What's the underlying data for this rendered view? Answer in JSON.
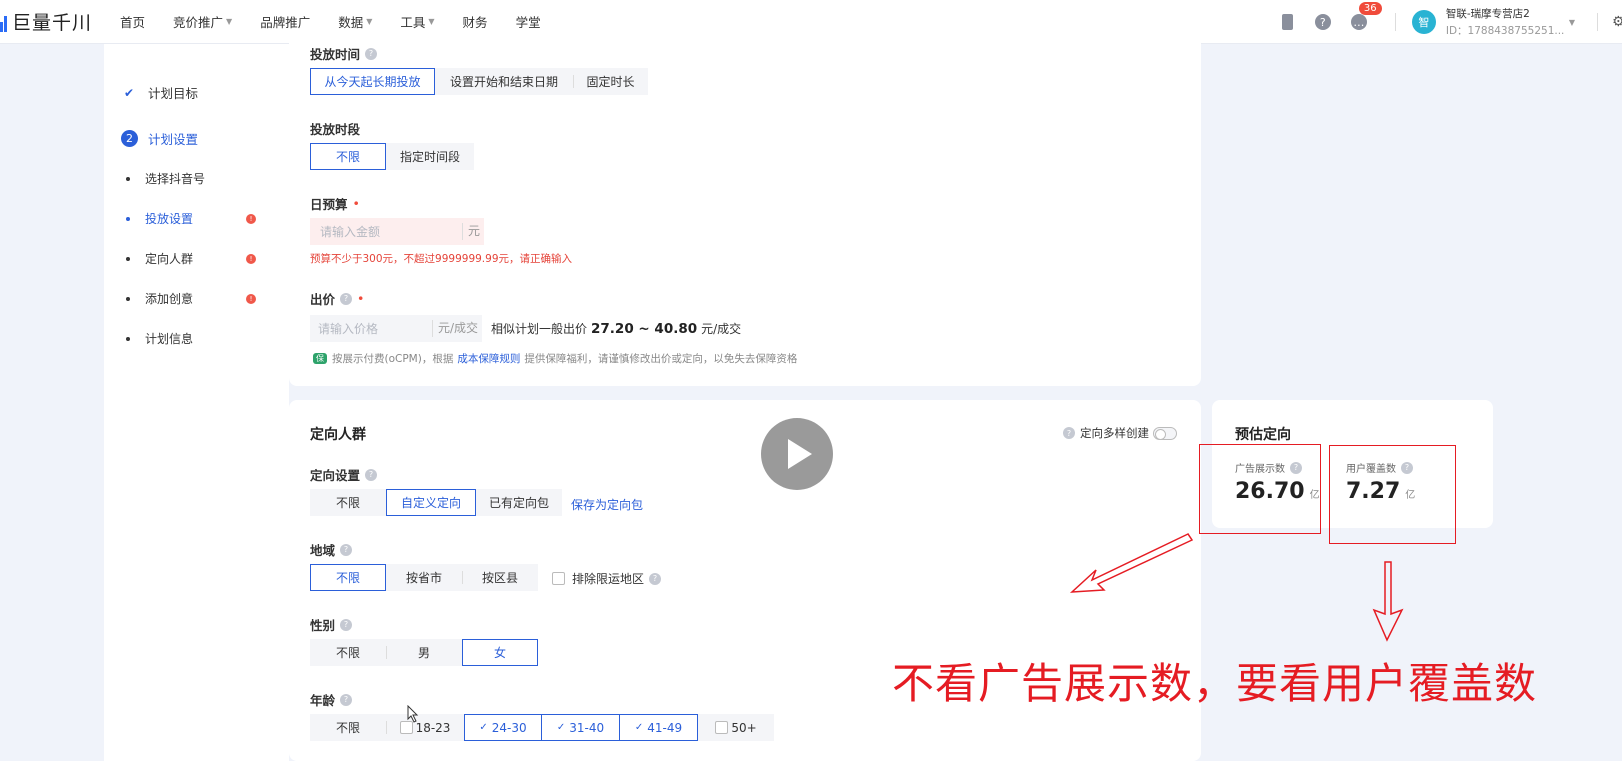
{
  "app": {
    "name": "巨量千川"
  },
  "nav": [
    {
      "label": "首页",
      "dropdown": false
    },
    {
      "label": "竞价推广",
      "dropdown": true
    },
    {
      "label": "品牌推广",
      "dropdown": false
    },
    {
      "label": "数据",
      "dropdown": true
    },
    {
      "label": "工具",
      "dropdown": true
    },
    {
      "label": "财务",
      "dropdown": false
    },
    {
      "label": "学堂",
      "dropdown": false
    }
  ],
  "header": {
    "notification_count": "36",
    "avatar_text": "智",
    "account_name": "智联-瑞摩专营店2",
    "account_id": "ID：1788438755251..."
  },
  "sidebar": {
    "step1": "计划目标",
    "step2_num": "2",
    "step2": "计划设置",
    "items": [
      {
        "label": "选择抖音号",
        "error": false
      },
      {
        "label": "投放设置",
        "error": true
      },
      {
        "label": "定向人群",
        "error": true
      },
      {
        "label": "添加创意",
        "error": true
      },
      {
        "label": "计划信息",
        "error": false
      }
    ]
  },
  "delivery": {
    "time_label": "投放时间",
    "time_options": [
      "从今天起长期投放",
      "设置开始和结束日期",
      "固定时长"
    ],
    "period_label": "投放时段",
    "period_options": [
      "不限",
      "指定时间段"
    ],
    "budget_label": "日预算",
    "budget_placeholder": "请输入金额",
    "budget_unit": "元",
    "budget_error": "预算不少于300元，不超过9999999.99元，请正确输入",
    "bid_label": "出价",
    "bid_placeholder": "请输入价格",
    "bid_unit": "元/成交",
    "bid_hint_prefix": "相似计划一般出价",
    "bid_hint_range": "27.20 ~ 40.80",
    "bid_hint_suffix": "元/成交",
    "note_badge": "保",
    "note_prefix": "按展示付费(oCPM)，根据",
    "note_link": "成本保障规则",
    "note_suffix": "提供保障福利，请谨慎修改出价或定向，以免失去保障资格"
  },
  "targeting": {
    "title": "定向人群",
    "multi_create": "定向多样创建",
    "setting_label": "定向设置",
    "setting_options": [
      "不限",
      "自定义定向",
      "已有定向包"
    ],
    "save_pack": "保存为定向包",
    "region_label": "地域",
    "region_options": [
      "不限",
      "按省市",
      "按区县"
    ],
    "exclude_region": "排除限运地区",
    "gender_label": "性别",
    "gender_options": [
      "不限",
      "男",
      "女"
    ],
    "age_label": "年龄",
    "age_options": [
      "不限",
      "18-23",
      "24-30",
      "31-40",
      "41-49",
      "50+"
    ]
  },
  "estimate": {
    "title": "预估定向",
    "impressions_label": "广告展示数",
    "impressions_value": "26.70",
    "impressions_unit": "亿",
    "users_label": "用户覆盖数",
    "users_value": "7.27",
    "users_unit": "亿"
  },
  "annotation": {
    "text": "不看广告展示数，要看用户覆盖数",
    "color": "#e51c23"
  }
}
